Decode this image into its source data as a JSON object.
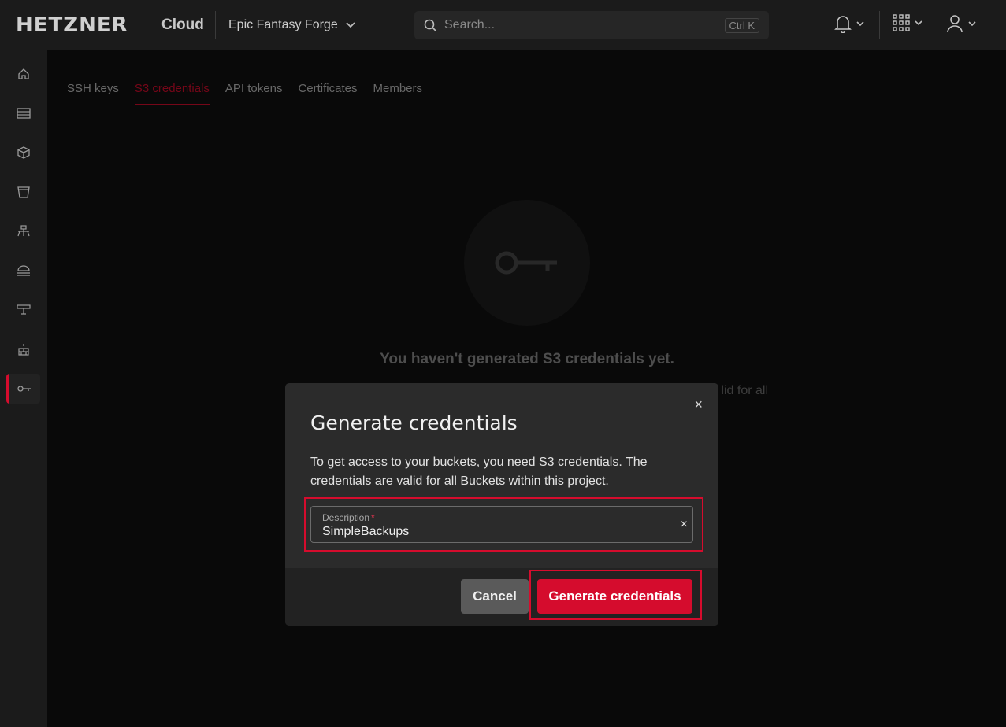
{
  "header": {
    "logo": "HETZNER",
    "product": "Cloud",
    "project": "Epic Fantasy Forge",
    "search_placeholder": "Search...",
    "search_shortcut": "Ctrl K"
  },
  "sidebar": {
    "items": [
      {
        "icon": "home-icon"
      },
      {
        "icon": "servers-icon"
      },
      {
        "icon": "cube-icon"
      },
      {
        "icon": "bucket-icon"
      },
      {
        "icon": "network-icon"
      },
      {
        "icon": "load-balancer-icon"
      },
      {
        "icon": "floating-ip-icon"
      },
      {
        "icon": "firewall-icon"
      },
      {
        "icon": "key-icon",
        "active": true
      }
    ]
  },
  "tabs": [
    {
      "label": "SSH keys"
    },
    {
      "label": "S3 credentials",
      "active": true
    },
    {
      "label": "API tokens"
    },
    {
      "label": "Certificates"
    },
    {
      "label": "Members"
    }
  ],
  "empty_state": {
    "title": "You haven't generated S3 credentials yet.",
    "subtitle_visible": "lid for all"
  },
  "modal": {
    "title": "Generate credentials",
    "close": "×",
    "text": "To get access to your buckets, you need S3 credentials. The credentials are valid for all Buckets within this project.",
    "field_label": "Description",
    "field_required": "*",
    "field_value": "SimpleBackups",
    "field_clear": "×",
    "cancel_label": "Cancel",
    "generate_label": "Generate credentials"
  },
  "colors": {
    "accent": "#d50c2d",
    "background": "#111111",
    "panel": "#1b1b1b",
    "modal": "#2b2b2b"
  }
}
